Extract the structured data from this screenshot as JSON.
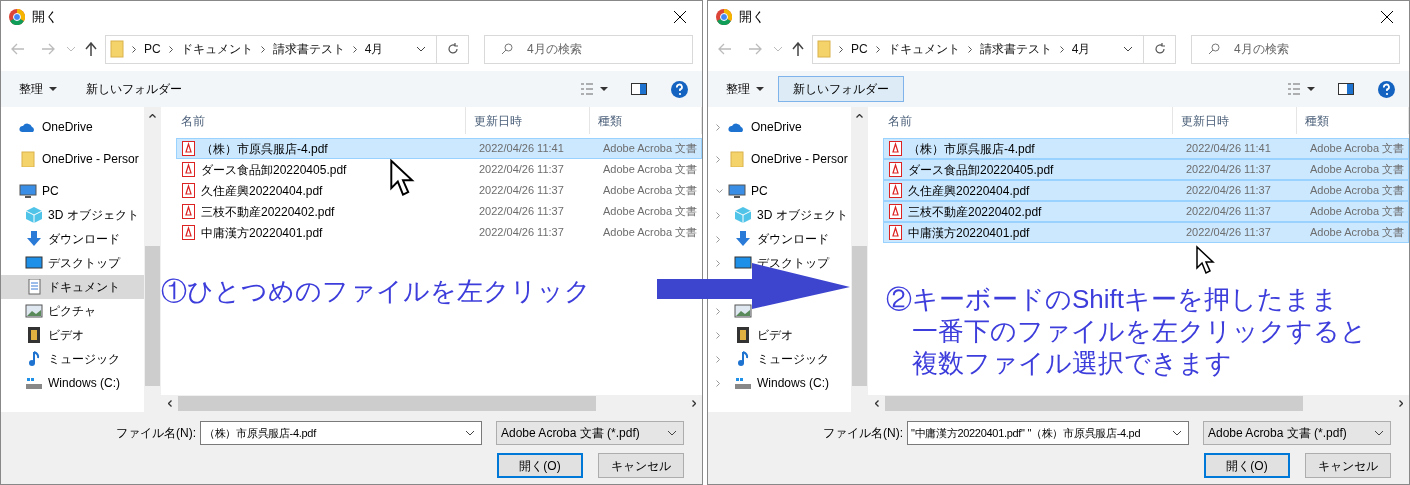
{
  "dialogs": [
    {
      "title": "開く",
      "breadcrumb": [
        "PC",
        "ドキュメント",
        "請求書テスト",
        "4月"
      ],
      "search": {
        "placeholder": "4月の検索"
      },
      "toolbar": {
        "organize": "整理",
        "new_folder": "新しいフォルダー",
        "new_folder_highlighted": false
      },
      "sidebar": [
        {
          "label": "OneDrive",
          "kind": "cloud",
          "selected": false
        },
        {
          "label": "OneDrive - Persor",
          "kind": "folder",
          "selected": false
        },
        {
          "label": "PC",
          "kind": "pc",
          "selected": false
        },
        {
          "label": "3D オブジェクト",
          "kind": "cube",
          "selected": false
        },
        {
          "label": "ダウンロード",
          "kind": "download",
          "selected": false
        },
        {
          "label": "デスクトップ",
          "kind": "desktop",
          "selected": false
        },
        {
          "label": "ドキュメント",
          "kind": "document",
          "selected": true
        },
        {
          "label": "ピクチャ",
          "kind": "picture",
          "selected": false
        },
        {
          "label": "ビデオ",
          "kind": "video",
          "selected": false
        },
        {
          "label": "ミュージック",
          "kind": "music",
          "selected": false
        },
        {
          "label": "Windows (C:)",
          "kind": "drive",
          "selected": false
        }
      ],
      "columns": [
        "名前",
        "更新日時",
        "種類"
      ],
      "files": [
        {
          "name": "（株）市原呉服店-4.pdf",
          "date": "2022/04/26 11:41",
          "type": "Adobe Acroba 文書",
          "selected": true
        },
        {
          "name": "ダース食品卸20220405.pdf",
          "date": "2022/04/26 11:37",
          "type": "Adobe Acroba 文書",
          "selected": false
        },
        {
          "name": "久住産興20220404.pdf",
          "date": "2022/04/26 11:37",
          "type": "Adobe Acroba 文書",
          "selected": false
        },
        {
          "name": "三枝不動産20220402.pdf",
          "date": "2022/04/26 11:37",
          "type": "Adobe Acroba 文書",
          "selected": false
        },
        {
          "name": "中庸漢方20220401.pdf",
          "date": "2022/04/26 11:37",
          "type": "Adobe Acroba 文書",
          "selected": false
        }
      ],
      "filename_label": "ファイル名(N):",
      "filename": "（株）市原呉服店-4.pdf",
      "filetype": "Adobe Acroba 文書 (*.pdf)",
      "open_button": "開く(O)",
      "cancel_button": "キャンセル",
      "annotation": [
        "①ひとつめのファイルを左クリック"
      ]
    },
    {
      "title": "開く",
      "breadcrumb": [
        "PC",
        "ドキュメント",
        "請求書テスト",
        "4月"
      ],
      "search": {
        "placeholder": "4月の検索"
      },
      "toolbar": {
        "organize": "整理",
        "new_folder": "新しいフォルダー",
        "new_folder_highlighted": true
      },
      "sidebar": [
        {
          "label": "OneDrive",
          "kind": "cloud",
          "selected": false,
          "expanded": false
        },
        {
          "label": "OneDrive - Persor",
          "kind": "folder",
          "selected": false,
          "expanded": false
        },
        {
          "label": "PC",
          "kind": "pc",
          "selected": false,
          "expanded": true
        },
        {
          "label": "3D オブジェクト",
          "kind": "cube",
          "selected": false,
          "expanded": false
        },
        {
          "label": "ダウンロード",
          "kind": "download",
          "selected": false,
          "expanded": false
        },
        {
          "label": "デスクトップ",
          "kind": "desktop",
          "selected": false,
          "expanded": false
        },
        {
          "kind": "covered"
        },
        {
          "kind": "picture",
          "selected": false,
          "expanded": false
        },
        {
          "label": "ビデオ",
          "kind": "video",
          "selected": false,
          "expanded": false
        },
        {
          "label": "ミュージック",
          "kind": "music",
          "selected": false,
          "expanded": false
        },
        {
          "label": "Windows (C:)",
          "kind": "drive",
          "selected": false,
          "expanded": false
        }
      ],
      "columns": [
        "名前",
        "更新日時",
        "種類"
      ],
      "files": [
        {
          "name": "（株）市原呉服店-4.pdf",
          "date": "2022/04/26 11:41",
          "type": "Adobe Acroba 文書",
          "selected": true
        },
        {
          "name": "ダース食品卸20220405.pdf",
          "date": "2022/04/26 11:37",
          "type": "Adobe Acroba 文書",
          "selected": true
        },
        {
          "name": "久住産興20220404.pdf",
          "date": "2022/04/26 11:37",
          "type": "Adobe Acroba 文書",
          "selected": true
        },
        {
          "name": "三枝不動産20220402.pdf",
          "date": "2022/04/26 11:37",
          "type": "Adobe Acroba 文書",
          "selected": true
        },
        {
          "name": "中庸漢方20220401.pdf",
          "date": "2022/04/26 11:37",
          "type": "Adobe Acroba 文書",
          "selected": true
        }
      ],
      "filename_label": "ファイル名(N):",
      "filename": "\"中庸漢方20220401.pdf\" \"（株）市原呉服店-4.pd",
      "filetype": "Adobe Acroba 文書 (*.pdf)",
      "open_button": "開く(O)",
      "cancel_button": "キャンセル",
      "annotation": [
        "②キーボードのShiftキーを押したまま",
        "一番下のファイルを左クリックすると",
        "複数ファイル選択できます"
      ]
    }
  ]
}
